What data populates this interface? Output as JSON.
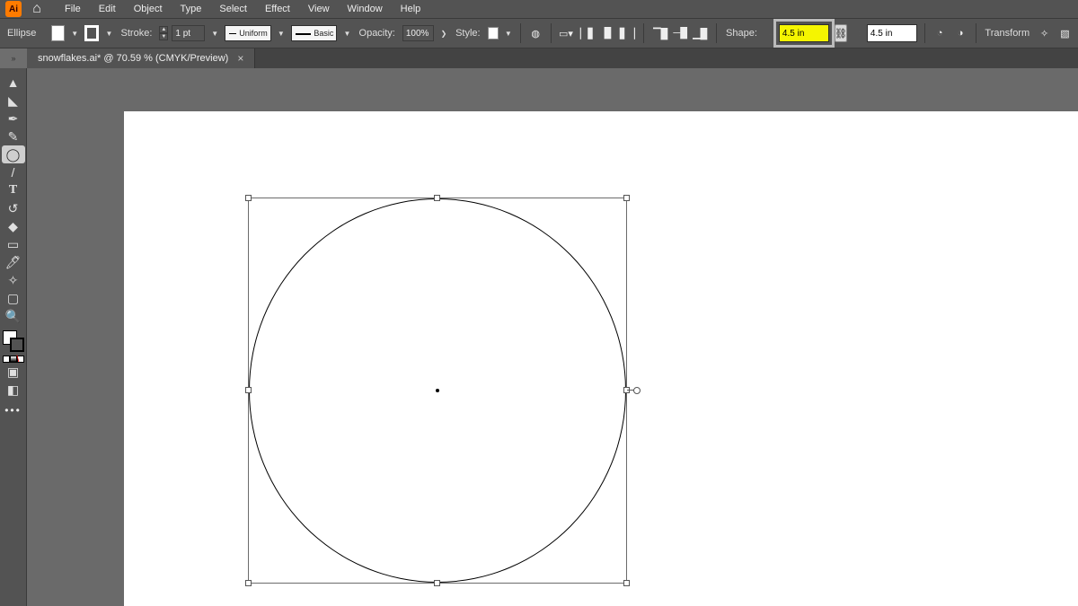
{
  "app": {
    "badge": "Ai"
  },
  "menu": {
    "items": [
      "File",
      "Edit",
      "Object",
      "Type",
      "Select",
      "Effect",
      "View",
      "Window",
      "Help"
    ]
  },
  "control": {
    "tool_name": "Ellipse",
    "stroke_label": "Stroke:",
    "stroke_weight": "1 pt",
    "profile_label": "Uniform",
    "brush_label": "Basic",
    "opacity_label": "Opacity:",
    "opacity_value": "100%",
    "style_label": "Style:",
    "shape_label": "Shape:",
    "width_value": "4.5 in",
    "height_value": "4.5 in",
    "transform_label": "Transform"
  },
  "tab": {
    "title": "snowflakes.ai* @ 70.59 % (CMYK/Preview)"
  },
  "tools": [
    {
      "name": "selection-tool",
      "glyph": "▲"
    },
    {
      "name": "direct-selection-tool",
      "glyph": "◣"
    },
    {
      "name": "pen-tool",
      "glyph": "✒"
    },
    {
      "name": "curvature-tool",
      "glyph": "✎"
    },
    {
      "name": "ellipse-tool",
      "glyph": "◯",
      "active": true
    },
    {
      "name": "paintbrush-tool",
      "glyph": "/"
    },
    {
      "name": "type-tool",
      "glyph": "T"
    },
    {
      "name": "rotate-tool",
      "glyph": "↺"
    },
    {
      "name": "shape-builder-tool",
      "glyph": "◆"
    },
    {
      "name": "gradient-tool",
      "glyph": "▭"
    },
    {
      "name": "eyedropper-tool",
      "glyph": "🖊"
    },
    {
      "name": "symbol-sprayer-tool",
      "glyph": "✧"
    },
    {
      "name": "artboard-tool",
      "glyph": "▢"
    },
    {
      "name": "zoom-tool",
      "glyph": "🔍"
    }
  ]
}
